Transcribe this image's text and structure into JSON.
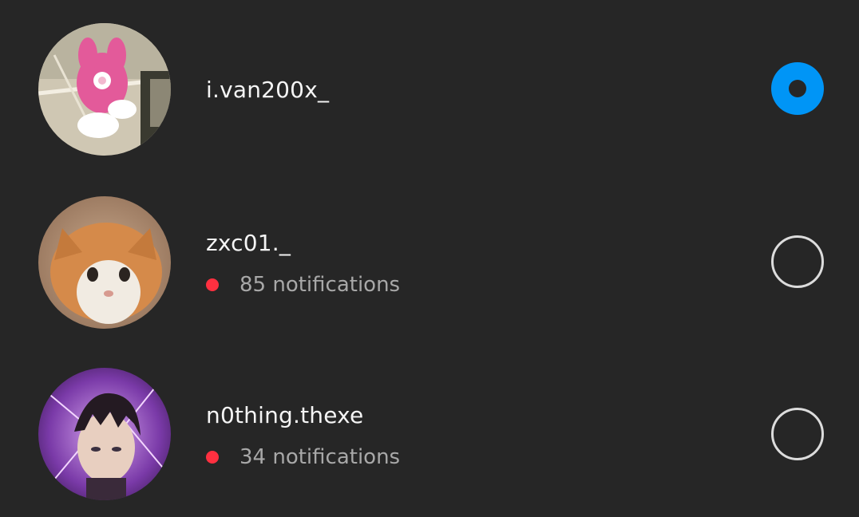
{
  "accounts": [
    {
      "username": "i.van200x_",
      "selected": true,
      "notifications": null,
      "avatar": "pink-bunny-cartoon-avatar"
    },
    {
      "username": "zxc01._",
      "selected": false,
      "notifications": "85 notifications",
      "avatar": "orange-kitten-avatar"
    },
    {
      "username": "n0thing.thexe",
      "selected": false,
      "notifications": "34 notifications",
      "avatar": "anime-character-purple-avatar"
    }
  ],
  "colors": {
    "background": "#262626",
    "selected_radio": "#0095f6",
    "notification_dot": "#ff3040",
    "username_text": "#f5f5f5",
    "notification_text": "#a8a8a8"
  }
}
